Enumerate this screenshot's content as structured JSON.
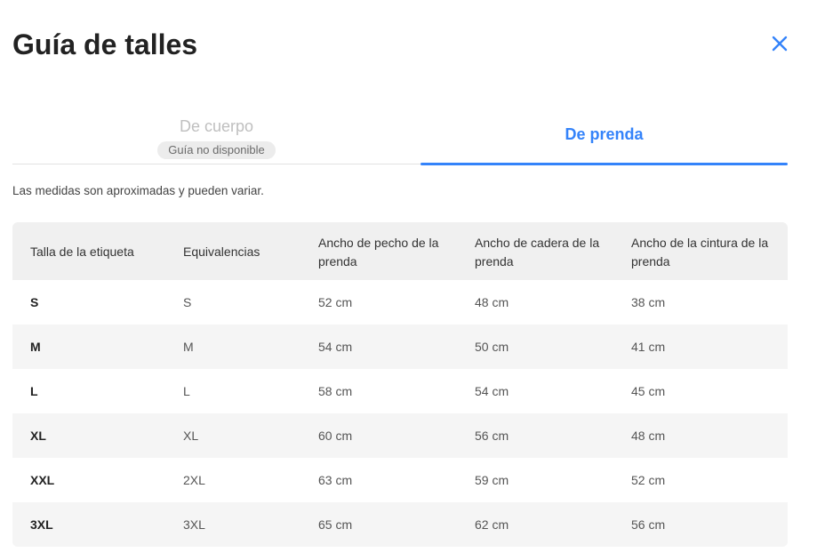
{
  "modal": {
    "title": "Guía de talles",
    "close_icon": "close-icon",
    "accent_color": "#3483fa"
  },
  "tabs": [
    {
      "label": "De cuerpo",
      "badge": "Guía no disponible",
      "active": false
    },
    {
      "label": "De prenda",
      "active": true
    }
  ],
  "note": "Las medidas son aproximadas y pueden variar.",
  "table": {
    "headers": [
      "Talla de la etiqueta",
      "Equivalencias",
      "Ancho de pecho de la prenda",
      "Ancho de cadera de la prenda",
      "Ancho de la cintura de la prenda"
    ],
    "rows": [
      [
        "S",
        "S",
        "52 cm",
        "48 cm",
        "38 cm"
      ],
      [
        "M",
        "M",
        "54 cm",
        "50 cm",
        "41 cm"
      ],
      [
        "L",
        "L",
        "58 cm",
        "54 cm",
        "45 cm"
      ],
      [
        "XL",
        "XL",
        "60 cm",
        "56 cm",
        "48 cm"
      ],
      [
        "XXL",
        "2XL",
        "63 cm",
        "59 cm",
        "52 cm"
      ],
      [
        "3XL",
        "3XL",
        "65 cm",
        "62 cm",
        "56 cm"
      ]
    ]
  }
}
